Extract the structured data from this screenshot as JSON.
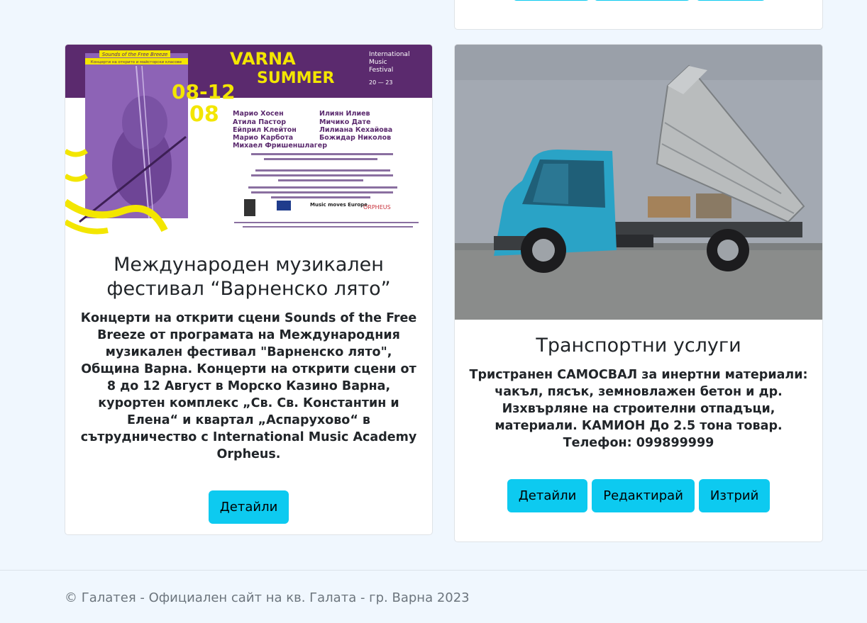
{
  "cards": [
    {
      "title": "Международен музикален фестивал “Варненско лято”",
      "text": "Концерти на открити сцени Sounds of the Free Breeze от програмата на Международния музикален фестивал \"Варненско лято\", Община Варна. Концерти на открити сцени от 8 до 12 Август в Морско Казино Варна, курортен комплекс „Св. Св. Константин и Елена“ и квартал „Аспарухово“ в сътрудничество с International Music Academy Orpheus.",
      "buttons": {
        "details": "Детайли"
      },
      "poster": {
        "series": "Sounds of the Free Breeze",
        "subtitle": "Концерти на открито и майсторски класове",
        "festival_line1": "VARNA",
        "festival_line2": "SUMMER",
        "festival_info_1": "International",
        "festival_info_2": "Music",
        "festival_info_3": "Festival",
        "festival_years": "20 — 23",
        "dates_1": "08-12",
        "dates_2": "08",
        "artists_left": [
          "Марио Хосен",
          "Атила Пастор",
          "Ейприл Клейтон",
          "Марио Карбота",
          "Михаел Фришеншлагер"
        ],
        "artists_right": [
          "Илиян Илиев",
          "Мичико Дате",
          "Лилиана Кехайова",
          "Божидар Николов"
        ],
        "logo_music": "Music moves Europe",
        "logo_orpheus": "ORPHEUS"
      }
    },
    {
      "title": "Транспортни услуги",
      "text": "Тристранен САМОСВАЛ за инертни материали: чакъл, пясък, земновлажен бетон и др. Изхвърляне на строителни отпадъци, материали. КАМИОН До 2.5 тона товар. Телефон: 099899999",
      "buttons": {
        "details": "Детайли",
        "edit": "Редактирай",
        "delete": "Изтрий"
      }
    }
  ],
  "footer": {
    "copyright": "© Галатея - Официален сайт на кв. Галата - гр. Варна 2023"
  },
  "colors": {
    "accent": "#0dcaf0",
    "background": "#f0f7fe",
    "poster_purple": "#5b2a6e",
    "poster_yellow": "#f3e600"
  }
}
